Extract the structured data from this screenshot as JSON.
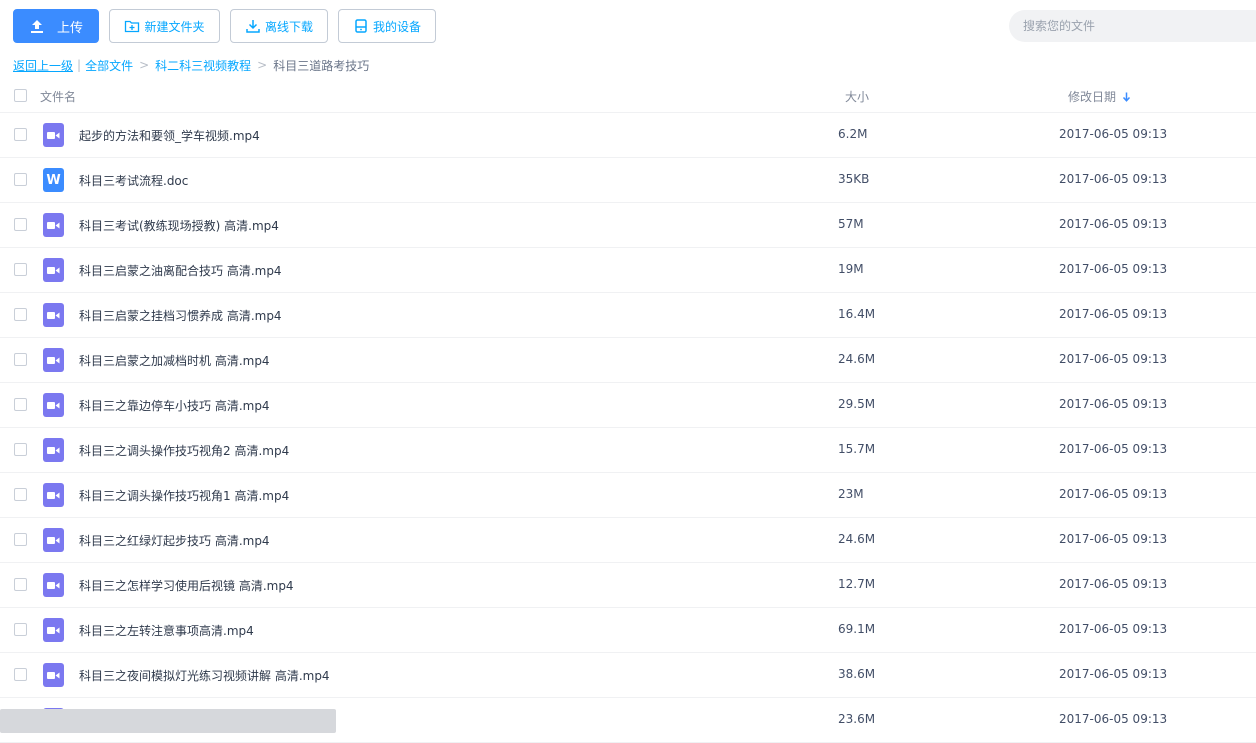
{
  "toolbar": {
    "upload": "上传",
    "new_folder": "新建文件夹",
    "offline_download": "离线下载",
    "my_devices": "我的设备"
  },
  "search": {
    "placeholder": "搜索您的文件"
  },
  "breadcrumb": {
    "back": "返回上一级",
    "all_files": "全部文件",
    "parent": "科二科三视频教程",
    "current": "科目三道路考技巧"
  },
  "columns": {
    "name": "文件名",
    "size": "大小",
    "date": "修改日期",
    "sort": "descending"
  },
  "colors": {
    "accent": "#06a7ff",
    "primary_button": "#3b8cff",
    "video_icon": "#7b78f0",
    "doc_icon": "#3b8cff"
  },
  "files": [
    {
      "name": "起步的方法和要领_学车视频.mp4",
      "size": "6.2M",
      "date": "2017-06-05 09:13",
      "icon": "video-file-icon"
    },
    {
      "name": "科目三考试流程.doc",
      "size": "35KB",
      "date": "2017-06-05 09:13",
      "icon": "word-file-icon"
    },
    {
      "name": "科目三考试(教练现场授教) 高清.mp4",
      "size": "57M",
      "date": "2017-06-05 09:13",
      "icon": "video-file-icon"
    },
    {
      "name": "科目三启蒙之油离配合技巧 高清.mp4",
      "size": "19M",
      "date": "2017-06-05 09:13",
      "icon": "video-file-icon"
    },
    {
      "name": "科目三启蒙之挂档习惯养成 高清.mp4",
      "size": "16.4M",
      "date": "2017-06-05 09:13",
      "icon": "video-file-icon"
    },
    {
      "name": "科目三启蒙之加减档时机 高清.mp4",
      "size": "24.6M",
      "date": "2017-06-05 09:13",
      "icon": "video-file-icon"
    },
    {
      "name": "科目三之靠边停车小技巧 高清.mp4",
      "size": "29.5M",
      "date": "2017-06-05 09:13",
      "icon": "video-file-icon"
    },
    {
      "name": "科目三之调头操作技巧视角2 高清.mp4",
      "size": "15.7M",
      "date": "2017-06-05 09:13",
      "icon": "video-file-icon"
    },
    {
      "name": "科目三之调头操作技巧视角1 高清.mp4",
      "size": "23M",
      "date": "2017-06-05 09:13",
      "icon": "video-file-icon"
    },
    {
      "name": "科目三之红绿灯起步技巧 高清.mp4",
      "size": "24.6M",
      "date": "2017-06-05 09:13",
      "icon": "video-file-icon"
    },
    {
      "name": "科目三之怎样学习使用后视镜 高清.mp4",
      "size": "12.7M",
      "date": "2017-06-05 09:13",
      "icon": "video-file-icon"
    },
    {
      "name": "科目三之左转注意事项高清.mp4",
      "size": "69.1M",
      "date": "2017-06-05 09:13",
      "icon": "video-file-icon"
    },
    {
      "name": "科目三之夜间模拟灯光练习视频讲解 高清.mp4",
      "size": "38.6M",
      "date": "2017-06-05 09:13",
      "icon": "video-file-icon"
    },
    {
      "name": "",
      "size": "23.6M",
      "date": "2017-06-05 09:13",
      "icon": "video-file-icon"
    }
  ]
}
